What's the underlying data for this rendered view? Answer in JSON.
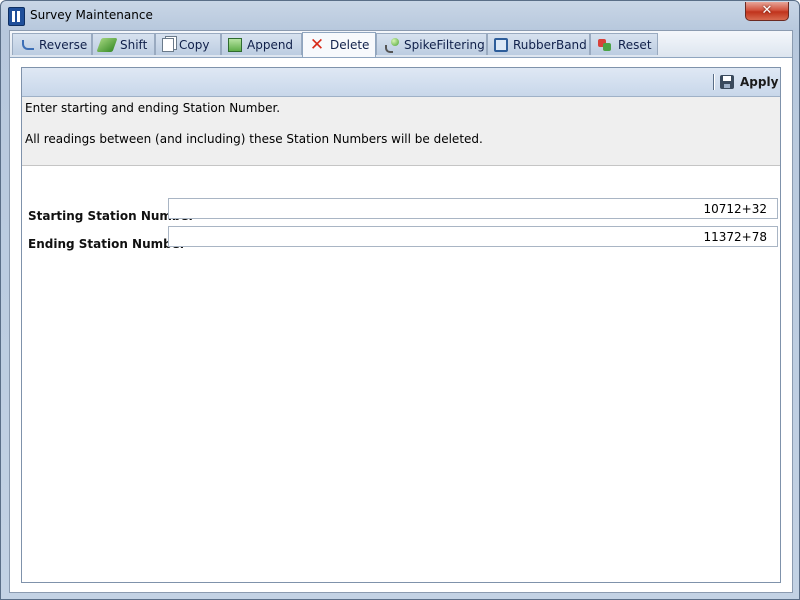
{
  "window": {
    "title": "Survey Maintenance",
    "close_label": "✕"
  },
  "tabs": [
    {
      "label": "Reverse",
      "icon": "reverse-arrow-icon"
    },
    {
      "label": "Shift",
      "icon": "shift-icon"
    },
    {
      "label": "Copy",
      "icon": "copy-icon"
    },
    {
      "label": "Append",
      "icon": "append-icon"
    },
    {
      "label": "Delete",
      "icon": "delete-x-icon",
      "active": true
    },
    {
      "label": "SpikeFiltering",
      "icon": "spike-filter-icon"
    },
    {
      "label": "RubberBand",
      "icon": "rubber-band-icon"
    },
    {
      "label": "Reset",
      "icon": "reset-icon"
    }
  ],
  "toolbar": {
    "apply_label": "Apply",
    "apply_icon": "save-icon"
  },
  "info": {
    "line1": "Enter starting and ending Station Number.",
    "line2": "All readings between (and including) these Station Numbers will be deleted."
  },
  "fields": {
    "starting": {
      "label": "Starting Station Number",
      "value": "10712+32"
    },
    "ending": {
      "label": "Ending Station Number",
      "value": "11372+78"
    }
  },
  "colors": {
    "delete_icon": "#d72a18",
    "close_button": "#c0331c"
  }
}
